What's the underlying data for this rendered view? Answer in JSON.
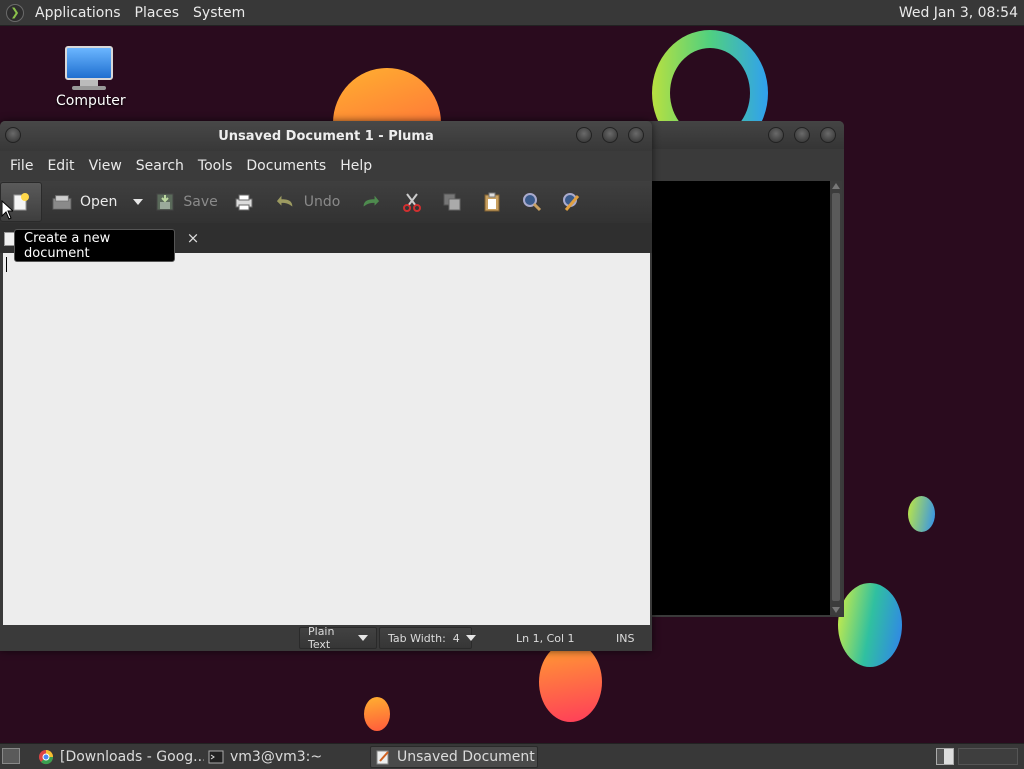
{
  "top_panel": {
    "menus": [
      "Applications",
      "Places",
      "System"
    ],
    "clock": "Wed Jan  3, 08:54"
  },
  "desktop": {
    "icons": [
      {
        "label": "Computer",
        "icon": "computer-icon"
      }
    ]
  },
  "editor_window": {
    "title": "Unsaved Document 1 - Pluma",
    "menu": [
      "File",
      "Edit",
      "View",
      "Search",
      "Tools",
      "Documents",
      "Help"
    ],
    "toolbar": {
      "new_icon": "new-document-icon",
      "open_label": "Open",
      "save_label": "Save",
      "undo_label": "Undo"
    },
    "tab_close": "×",
    "tooltip": "Create a new document",
    "status": {
      "language": "Plain Text",
      "tab_width": "Tab Width:  4",
      "position": "Ln 1, Col 1",
      "mode": "INS"
    }
  },
  "taskbar": {
    "tasks": [
      {
        "label": "[Downloads - Goog...",
        "icon": "chrome-icon",
        "active": false
      },
      {
        "label": "vm3@vm3:~",
        "icon": "terminal-icon",
        "active": false
      },
      {
        "label": "Unsaved Document ...",
        "icon": "text-editor-icon",
        "active": true
      }
    ]
  },
  "colors": {
    "desktop_bg": "#2a0b1e",
    "panel_bg": "#383838",
    "window_bg": "#3a3a3a",
    "editor_bg": "#ededed",
    "tooltip_bg": "#000000"
  }
}
